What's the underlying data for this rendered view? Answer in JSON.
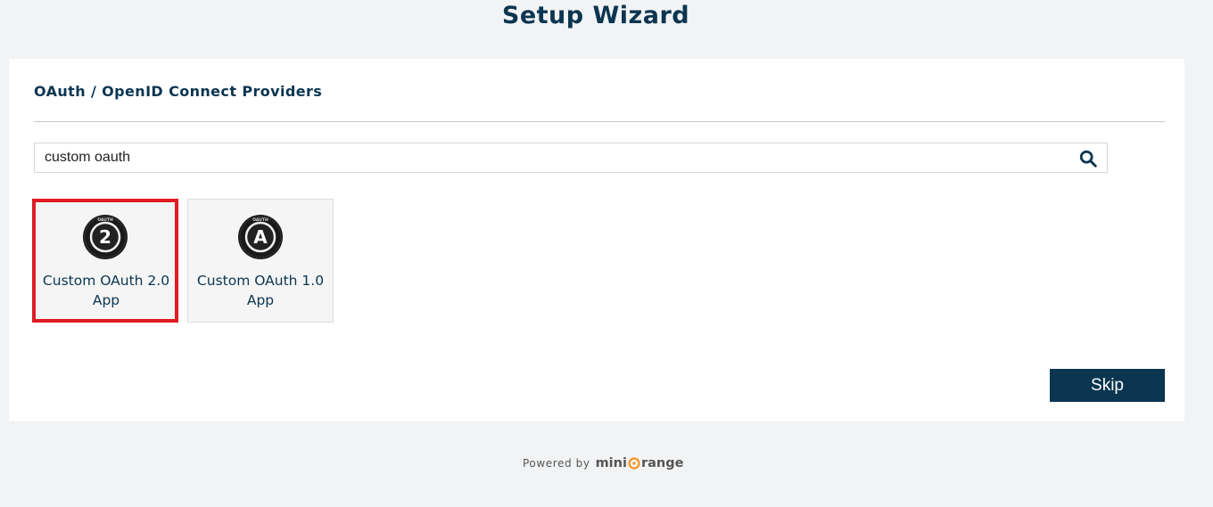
{
  "page": {
    "title": "Setup Wizard"
  },
  "panel": {
    "section_title": "OAuth / OpenID Connect Providers",
    "search": {
      "value": "custom oauth",
      "placeholder": "",
      "icon": "search-icon"
    },
    "providers": [
      {
        "label": "Custom OAuth 2.0 App",
        "logo_text": "2",
        "logo_ring_text": "OAUTH",
        "selected": true
      },
      {
        "label": "Custom OAuth 1.0 App",
        "logo_text": "A",
        "logo_ring_text": "OAUTH",
        "selected": false
      }
    ],
    "skip_label": "Skip"
  },
  "footer": {
    "powered_by": "Powered by",
    "brand_prefix": "mini",
    "brand_suffix": "range"
  },
  "colors": {
    "primary": "#0b3550",
    "selected_border": "#e01b22",
    "accent": "#f7941d",
    "background": "#f2f3f4"
  }
}
